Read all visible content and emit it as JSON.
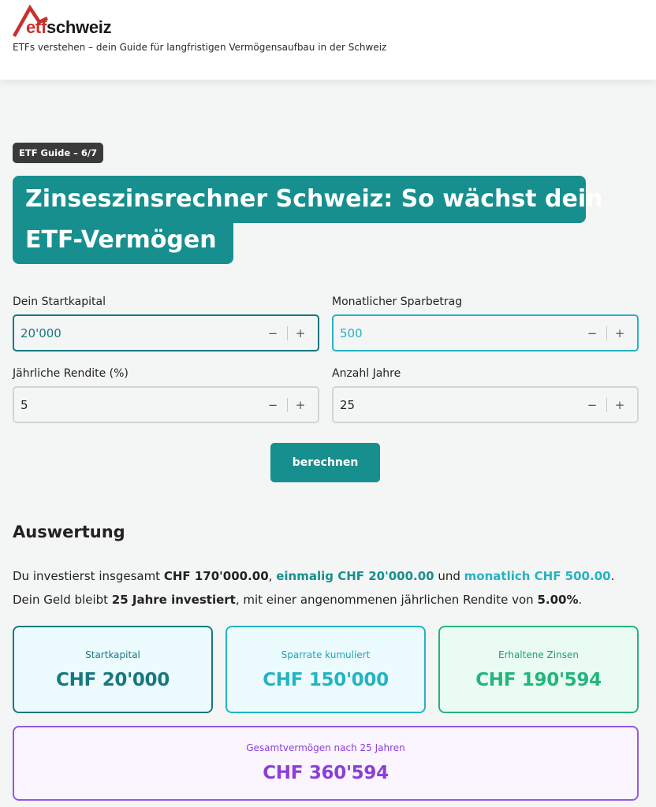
{
  "header": {
    "logo_etf": "etf",
    "logo_schweiz": "schweiz",
    "tagline": "ETFs verstehen – dein Guide für langfristigen Vermögensaufbau in der Schweiz",
    "brand_red": "#c8322e"
  },
  "guide": {
    "badge": "ETF Guide – 6/7",
    "title_line_1": "Zinseszinsrechner Schweiz: So wächst dein",
    "title_line_2": "ETF-Vermögen"
  },
  "form": {
    "startkapital": {
      "label": "Dein Startkapital",
      "value": "20'000"
    },
    "sparbetrag": {
      "label": "Monatlicher Sparbetrag",
      "value": "500"
    },
    "rendite": {
      "label": "Jährliche Rendite (%)",
      "value": "5"
    },
    "jahre": {
      "label": "Anzahl Jahre",
      "value": "25"
    },
    "stepper_minus": "−",
    "stepper_plus": "+",
    "submit_label": "berechnen"
  },
  "results": {
    "heading": "Auswertung",
    "line1": {
      "p1": "Du investierst insgesamt ",
      "total": "CHF 170'000.00",
      "p2": ", ",
      "einmalig": "einmalig CHF 20'000.00",
      "p3": " und ",
      "monatlich": "monatlich CHF 500.00",
      "p4": "."
    },
    "line2": {
      "p1": "Dein Geld bleibt ",
      "jahre": "25 Jahre investiert",
      "p2": ", mit einer angenommenen jährlichen Rendite von ",
      "rendite": "5.00%",
      "p3": "."
    },
    "cards": {
      "startkapital": {
        "label": "Startkapital",
        "value": "CHF 20'000"
      },
      "sparrate": {
        "label": "Sparrate kumuliert",
        "value": "CHF 150'000"
      },
      "zinsen": {
        "label": "Erhaltene Zinsen",
        "value": "CHF 190'594"
      },
      "gesamt": {
        "label": "Gesamtvermögen nach 25 Jahren",
        "value": "CHF 360'594"
      }
    }
  },
  "colors": {
    "accent_teal": "#178f8e",
    "accent_cyan": "#25b3c2",
    "accent_green": "#24b57c",
    "accent_purple": "#8a3fd8",
    "badge_dark": "#3a3a3a"
  }
}
